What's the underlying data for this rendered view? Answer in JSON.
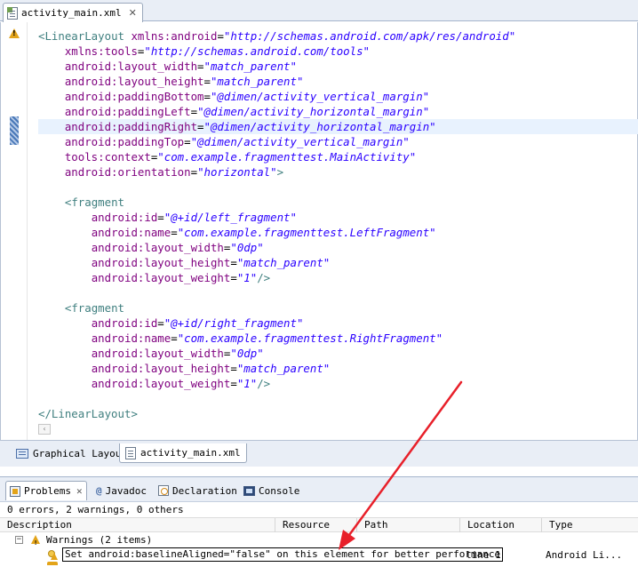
{
  "editor": {
    "tab_label": "activity_main.xml",
    "tab_close": "✕",
    "icons": {
      "file": "xml-file-icon",
      "warning": "warning-icon"
    },
    "scroll_left": "‹",
    "lines": [
      [
        {
          "c": "t-punct",
          "t": "<"
        },
        {
          "c": "t-tag",
          "t": "LinearLayout"
        },
        {
          "c": "t-eq",
          "t": " "
        },
        {
          "c": "t-attr",
          "t": "xmlns:android"
        },
        {
          "c": "t-eq",
          "t": "="
        },
        {
          "c": "t-val",
          "t": "\"http://schemas.android.com/apk/res/android\""
        }
      ],
      [
        {
          "c": "t-eq",
          "t": "    "
        },
        {
          "c": "t-attr",
          "t": "xmlns:tools"
        },
        {
          "c": "t-eq",
          "t": "="
        },
        {
          "c": "t-val",
          "t": "\"http://schemas.android.com/tools\""
        }
      ],
      [
        {
          "c": "t-eq",
          "t": "    "
        },
        {
          "c": "t-attr",
          "t": "android:layout_width"
        },
        {
          "c": "t-eq",
          "t": "="
        },
        {
          "c": "t-val",
          "t": "\"match_parent\""
        }
      ],
      [
        {
          "c": "t-eq",
          "t": "    "
        },
        {
          "c": "t-attr",
          "t": "android:layout_height"
        },
        {
          "c": "t-eq",
          "t": "="
        },
        {
          "c": "t-val",
          "t": "\"match_parent\""
        }
      ],
      [
        {
          "c": "t-eq",
          "t": "    "
        },
        {
          "c": "t-attr",
          "t": "android:paddingBottom"
        },
        {
          "c": "t-eq",
          "t": "="
        },
        {
          "c": "t-val",
          "t": "\"@dimen/activity_vertical_margin\""
        }
      ],
      [
        {
          "c": "t-eq",
          "t": "    "
        },
        {
          "c": "t-attr",
          "t": "android:paddingLeft"
        },
        {
          "c": "t-eq",
          "t": "="
        },
        {
          "c": "t-val",
          "t": "\"@dimen/activity_horizontal_margin\""
        }
      ],
      [
        {
          "c": "t-eq",
          "t": "    "
        },
        {
          "c": "t-attr",
          "t": "android:paddingRight"
        },
        {
          "c": "t-eq",
          "t": "="
        },
        {
          "c": "t-val",
          "t": "\"@dimen/activity_horizontal_margin\""
        }
      ],
      [
        {
          "c": "t-eq",
          "t": "    "
        },
        {
          "c": "t-attr",
          "t": "android:paddingTop"
        },
        {
          "c": "t-eq",
          "t": "="
        },
        {
          "c": "t-val",
          "t": "\"@dimen/activity_vertical_margin\""
        }
      ],
      [
        {
          "c": "t-eq",
          "t": "    "
        },
        {
          "c": "t-attr",
          "t": "tools:context"
        },
        {
          "c": "t-eq",
          "t": "="
        },
        {
          "c": "t-val",
          "t": "\"com.example.fragmenttest.MainActivity\""
        }
      ],
      [
        {
          "c": "t-eq",
          "t": "    "
        },
        {
          "c": "t-attr",
          "t": "android:orientation"
        },
        {
          "c": "t-eq",
          "t": "="
        },
        {
          "c": "t-val",
          "t": "\"horizontal\""
        },
        {
          "c": "t-punct",
          "t": ">"
        }
      ],
      [],
      [
        {
          "c": "t-eq",
          "t": "    "
        },
        {
          "c": "t-punct",
          "t": "<"
        },
        {
          "c": "t-tag",
          "t": "fragment"
        }
      ],
      [
        {
          "c": "t-eq",
          "t": "        "
        },
        {
          "c": "t-attr",
          "t": "android:id"
        },
        {
          "c": "t-eq",
          "t": "="
        },
        {
          "c": "t-val",
          "t": "\"@+id/left_fragment\""
        }
      ],
      [
        {
          "c": "t-eq",
          "t": "        "
        },
        {
          "c": "t-attr",
          "t": "android:name"
        },
        {
          "c": "t-eq",
          "t": "="
        },
        {
          "c": "t-val",
          "t": "\"com.example.fragmenttest.LeftFragment\""
        }
      ],
      [
        {
          "c": "t-eq",
          "t": "        "
        },
        {
          "c": "t-attr",
          "t": "android:layout_width"
        },
        {
          "c": "t-eq",
          "t": "="
        },
        {
          "c": "t-val",
          "t": "\"0dp\""
        }
      ],
      [
        {
          "c": "t-eq",
          "t": "        "
        },
        {
          "c": "t-attr",
          "t": "android:layout_height"
        },
        {
          "c": "t-eq",
          "t": "="
        },
        {
          "c": "t-val",
          "t": "\"match_parent\""
        }
      ],
      [
        {
          "c": "t-eq",
          "t": "        "
        },
        {
          "c": "t-attr",
          "t": "android:layout_weight"
        },
        {
          "c": "t-eq",
          "t": "="
        },
        {
          "c": "t-val",
          "t": "\"1\""
        },
        {
          "c": "t-punct",
          "t": "/>"
        }
      ],
      [],
      [
        {
          "c": "t-eq",
          "t": "    "
        },
        {
          "c": "t-punct",
          "t": "<"
        },
        {
          "c": "t-tag",
          "t": "fragment"
        }
      ],
      [
        {
          "c": "t-eq",
          "t": "        "
        },
        {
          "c": "t-attr",
          "t": "android:id"
        },
        {
          "c": "t-eq",
          "t": "="
        },
        {
          "c": "t-val",
          "t": "\"@+id/right_fragment\""
        }
      ],
      [
        {
          "c": "t-eq",
          "t": "        "
        },
        {
          "c": "t-attr",
          "t": "android:name"
        },
        {
          "c": "t-eq",
          "t": "="
        },
        {
          "c": "t-val",
          "t": "\"com.example.fragmenttest.RightFragment\""
        }
      ],
      [
        {
          "c": "t-eq",
          "t": "        "
        },
        {
          "c": "t-attr",
          "t": "android:layout_width"
        },
        {
          "c": "t-eq",
          "t": "="
        },
        {
          "c": "t-val",
          "t": "\"0dp\""
        }
      ],
      [
        {
          "c": "t-eq",
          "t": "        "
        },
        {
          "c": "t-attr",
          "t": "android:layout_height"
        },
        {
          "c": "t-eq",
          "t": "="
        },
        {
          "c": "t-val",
          "t": "\"match_parent\""
        }
      ],
      [
        {
          "c": "t-eq",
          "t": "        "
        },
        {
          "c": "t-attr",
          "t": "android:layout_weight"
        },
        {
          "c": "t-eq",
          "t": "="
        },
        {
          "c": "t-val",
          "t": "\"1\""
        },
        {
          "c": "t-punct",
          "t": "/>"
        }
      ],
      [],
      [
        {
          "c": "t-punct",
          "t": "</"
        },
        {
          "c": "t-tag",
          "t": "LinearLayout"
        },
        {
          "c": "t-punct",
          "t": ">"
        }
      ]
    ],
    "current_line_index": 6
  },
  "editor_tabs": {
    "graphical_label": "Graphical Layout",
    "xml_label": "activity_main.xml"
  },
  "problems_view": {
    "tabs": {
      "problems": "Problems",
      "problems_close": "✕",
      "javadoc": "Javadoc",
      "javadoc_glyph": "@",
      "declaration": "Declaration",
      "console": "Console"
    },
    "summary": "0 errors, 2 warnings, 0 others",
    "columns": {
      "description": "Description",
      "resource": "Resource",
      "path": "Path",
      "location": "Location",
      "type": "Type"
    },
    "group": {
      "toggle": "−",
      "label": "Warnings (2 items)"
    },
    "rows": [
      {
        "description": "Set android:baselineAligned=\"false\" on this element for better performance",
        "location": "line 1",
        "type": "Android Li..."
      }
    ]
  },
  "colors": {
    "tag": "#3f7f7f",
    "attribute": "#7f007f",
    "value": "#2a00ff",
    "warning": "#e3a41a",
    "annotation_arrow": "#e8202a"
  }
}
